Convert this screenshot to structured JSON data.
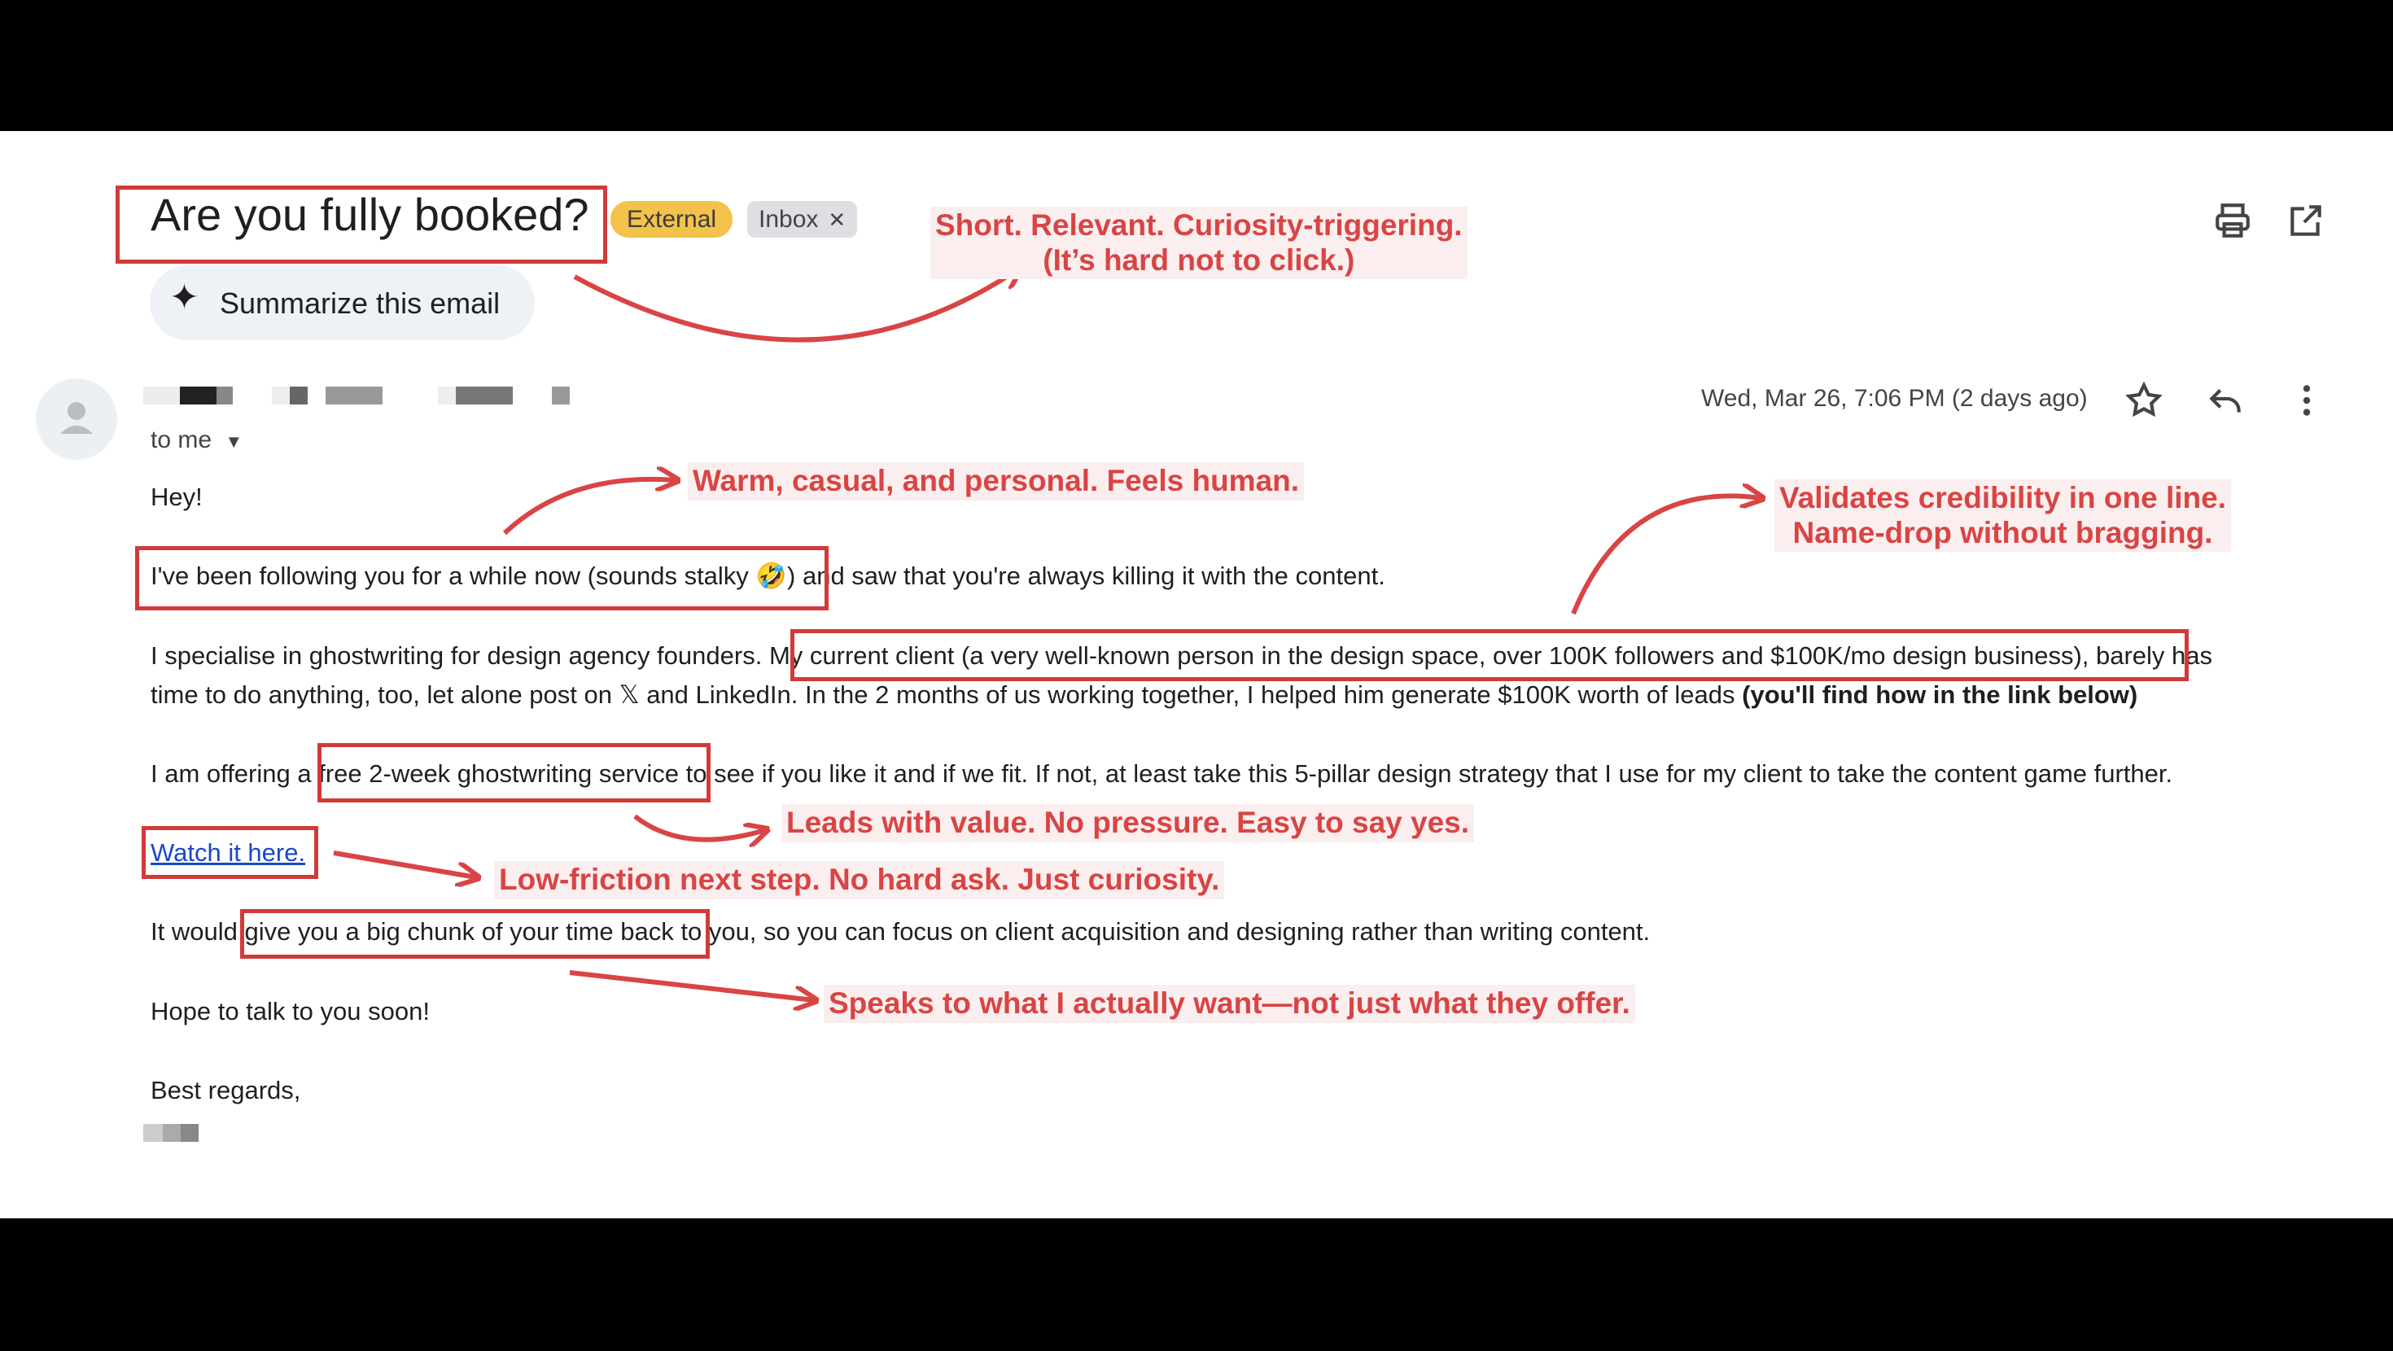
{
  "email": {
    "subject": "Are you fully booked?",
    "labels": {
      "external": "External",
      "inbox": "Inbox"
    },
    "summarize_label": "Summarize this email",
    "recipient": "to me",
    "date": "Wed, Mar 26, 7:06 PM (2 days ago)",
    "body": {
      "greeting": "Hey!",
      "p1_boxed": "I've been following you for a while now (sounds stalky 🤣)",
      "p1_rest": " and saw that you're always killing it with the content.",
      "p2_start": "I specialise in ghostwriting for design agency founders. ",
      "p2_boxed": "My current client (a very well-known person in the design space, over 100K followers and $100K/mo design business),",
      "p2_rest": " barely has",
      "p2_line2": "time to do anything, too, let alone post on 𝕏 and LinkedIn. In the 2 months of us working together, I helped him generate $100K worth of leads ",
      "p2_bold": "(you'll find how in the link below)",
      "p3_start": "I am offering a ",
      "p3_boxed": "free 2-week ghostwriting service",
      "p3_rest": " to see if you like it and if we fit. If not, at least take this 5-pillar design strategy that I use for my client to take the content game further.",
      "link": "Watch it here.",
      "p4_start": "It would ",
      "p4_boxed": "give you a big chunk of your time back",
      "p4_rest": " to you, so you can focus on client acquisition and designing rather than writing content.",
      "closing": "Hope to talk to you soon!",
      "signoff": "Best regards,"
    }
  },
  "annotations": {
    "subject_line1": "Short. Relevant. Curiosity-triggering.",
    "subject_line2": "(It’s hard not to click.)",
    "warm": "Warm, casual, and personal. Feels human.",
    "cred_line1": "Validates credibility in one line.",
    "cred_line2": "Name-drop without bragging.",
    "value": "Leads with value. No pressure. Easy to say yes.",
    "friction": "Low-friction next step. No hard ask. Just curiosity.",
    "want": "Speaks to what I actually want—not just what they offer."
  },
  "colors": {
    "annotation": "#d94444",
    "external_chip": "#f2c24b",
    "link": "#1a47c8"
  }
}
